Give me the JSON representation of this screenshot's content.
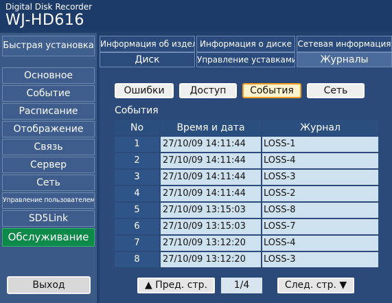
{
  "header": {
    "subtitle": "Digital Disk Recorder",
    "model": "WJ-HD616"
  },
  "sidebar": {
    "quick_setup": "Быстрая установка",
    "items": [
      "Основное",
      "Событие",
      "Расписание",
      "Отображение",
      "Связь",
      "Сервер",
      "Сеть",
      "Управление пользователем",
      "SD5Link",
      "Обслуживание"
    ],
    "active": "Обслуживание",
    "exit": "Выход"
  },
  "tabs": {
    "row1": [
      "Информация об изделии",
      "Информация о диске",
      "Сетевая информация"
    ],
    "row2": [
      "Диск",
      "Управление уставками",
      "Журналы"
    ],
    "active": "Журналы"
  },
  "filters": {
    "buttons": [
      "Ошибки",
      "Доступ",
      "События",
      "Сеть"
    ],
    "active": "События"
  },
  "log": {
    "title": "События",
    "columns": [
      "No",
      "Время и дата",
      "Журнал"
    ],
    "rows": [
      {
        "no": "1",
        "datetime": "27/10/09 14:11:44",
        "entry": "LOSS-1"
      },
      {
        "no": "2",
        "datetime": "27/10/09 14:11:44",
        "entry": "LOSS-4"
      },
      {
        "no": "3",
        "datetime": "27/10/09 14:11:44",
        "entry": "LOSS-3"
      },
      {
        "no": "4",
        "datetime": "27/10/09 14:11:44",
        "entry": "LOSS-2"
      },
      {
        "no": "5",
        "datetime": "27/10/09 13:15:03",
        "entry": "LOSS-8"
      },
      {
        "no": "6",
        "datetime": "27/10/09 13:15:03",
        "entry": "LOSS-7"
      },
      {
        "no": "7",
        "datetime": "27/10/09 13:12:20",
        "entry": "LOSS-4"
      },
      {
        "no": "8",
        "datetime": "27/10/09 13:12:20",
        "entry": "LOSS-3"
      }
    ]
  },
  "pager": {
    "prev": "▲ Пред. стр.",
    "page": "1/4",
    "next": "След. стр. ▼"
  },
  "colors": {
    "active_nav": "#0d8a4a",
    "active_filter_border": "#f5a020",
    "cell_bg": "#cde1ef"
  }
}
